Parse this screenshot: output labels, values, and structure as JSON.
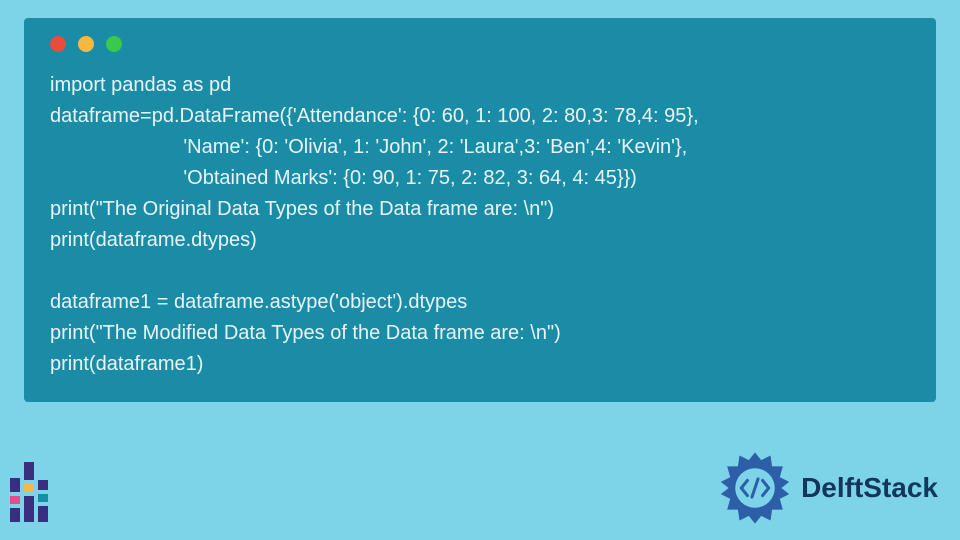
{
  "code": {
    "lines": [
      "import pandas as pd",
      "dataframe=pd.DataFrame({'Attendance': {0: 60, 1: 100, 2: 80,3: 78,4: 95},",
      "                        'Name': {0: 'Olivia', 1: 'John', 2: 'Laura',3: 'Ben',4: 'Kevin'},",
      "                        'Obtained Marks': {0: 90, 1: 75, 2: 82, 3: 64, 4: 45}})",
      "print(\"The Original Data Types of the Data frame are: \\n\")",
      "print(dataframe.dtypes)",
      "",
      "dataframe1 = dataframe.astype('object').dtypes",
      "print(\"The Modified Data Types of the Data frame are: \\n\")",
      "print(dataframe1)"
    ]
  },
  "brand": {
    "name": "DelftStack"
  },
  "colors": {
    "panel": "#1B8CA6",
    "page": "#7DD3E8",
    "text": "#E8F4F8",
    "brand_text": "#14365C",
    "gear": "#2C5FA8"
  }
}
